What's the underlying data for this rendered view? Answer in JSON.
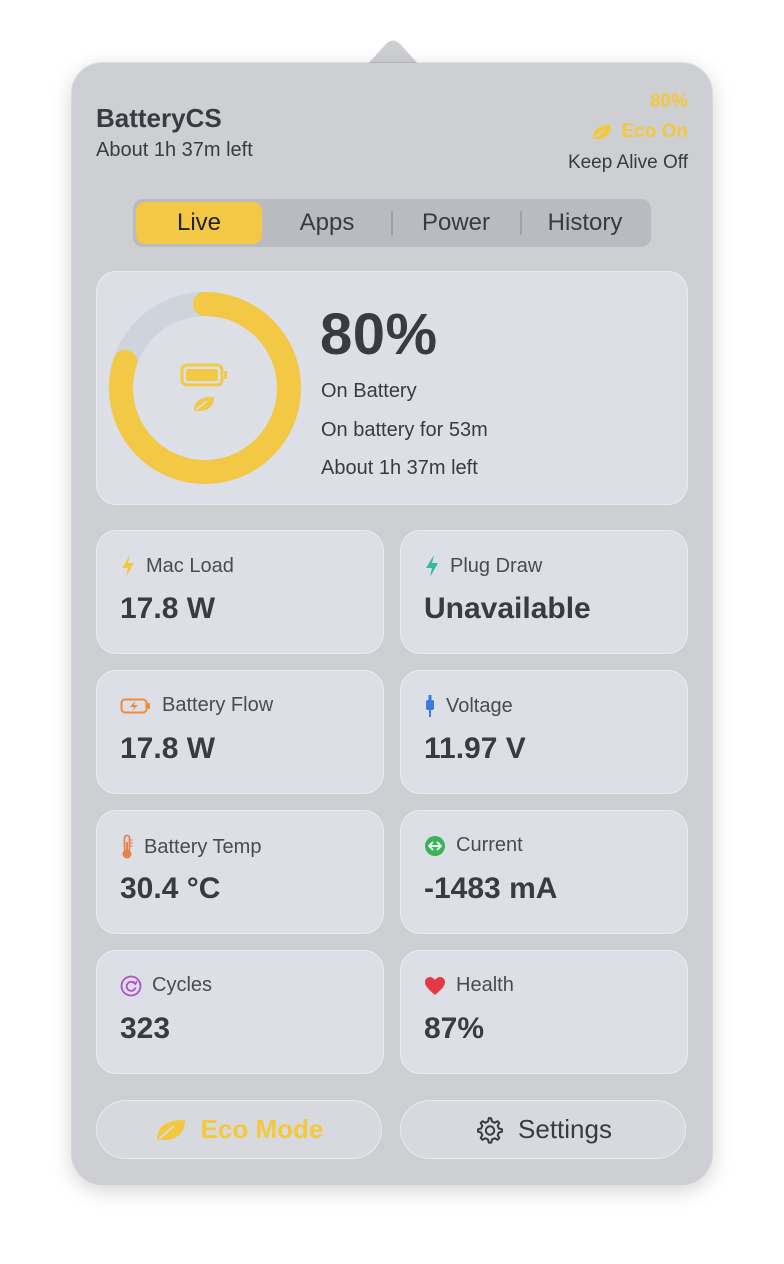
{
  "app": {
    "title": "BatteryCS",
    "time_left": "About 1h 37m left"
  },
  "header_status": {
    "percent": "80%",
    "eco": "Eco On",
    "keep_alive": "Keep Alive Off"
  },
  "tabs": [
    {
      "label": "Live",
      "active": true
    },
    {
      "label": "Apps",
      "active": false
    },
    {
      "label": "Power",
      "active": false
    },
    {
      "label": "History",
      "active": false
    }
  ],
  "battery": {
    "percent_text": "80%",
    "level": 0.8,
    "state": "On Battery",
    "duration": "On battery for 53m",
    "remaining": "About 1h 37m left"
  },
  "metrics": [
    {
      "label": "Mac Load",
      "value": "17.8 W",
      "icon": "bolt-icon"
    },
    {
      "label": "Plug Draw",
      "value": "Unavailable",
      "icon": "bolt-icon"
    },
    {
      "label": "Battery Flow",
      "value": "17.8 W",
      "icon": "battery-charging-icon"
    },
    {
      "label": "Voltage",
      "value": "11.97 V",
      "icon": "plug-icon"
    },
    {
      "label": "Battery Temp",
      "value": "30.4 °C",
      "icon": "thermometer-icon"
    },
    {
      "label": "Current",
      "value": "-1483 mA",
      "icon": "arrows-left-right-icon"
    },
    {
      "label": "Cycles",
      "value": "323",
      "icon": "cycle-icon"
    },
    {
      "label": "Health",
      "value": "87%",
      "icon": "heart-icon"
    }
  ],
  "buttons": {
    "eco_mode": "Eco Mode",
    "settings": "Settings"
  },
  "colors": {
    "accent": "#f3c845",
    "panel": "#cdcfd3",
    "card": "#dcdfe5",
    "text": "#3a3b40",
    "ring_track": "#cfd3db",
    "bolt_yellow": "#f3c83c",
    "bolt_teal": "#37b8a6",
    "battery_orange": "#f08a3c",
    "voltage_blue": "#3a7be0",
    "temp_orange": "#e8824a",
    "current_green": "#3cb35a",
    "cycles_purple": "#b04fd0",
    "health_red": "#e23a44"
  }
}
